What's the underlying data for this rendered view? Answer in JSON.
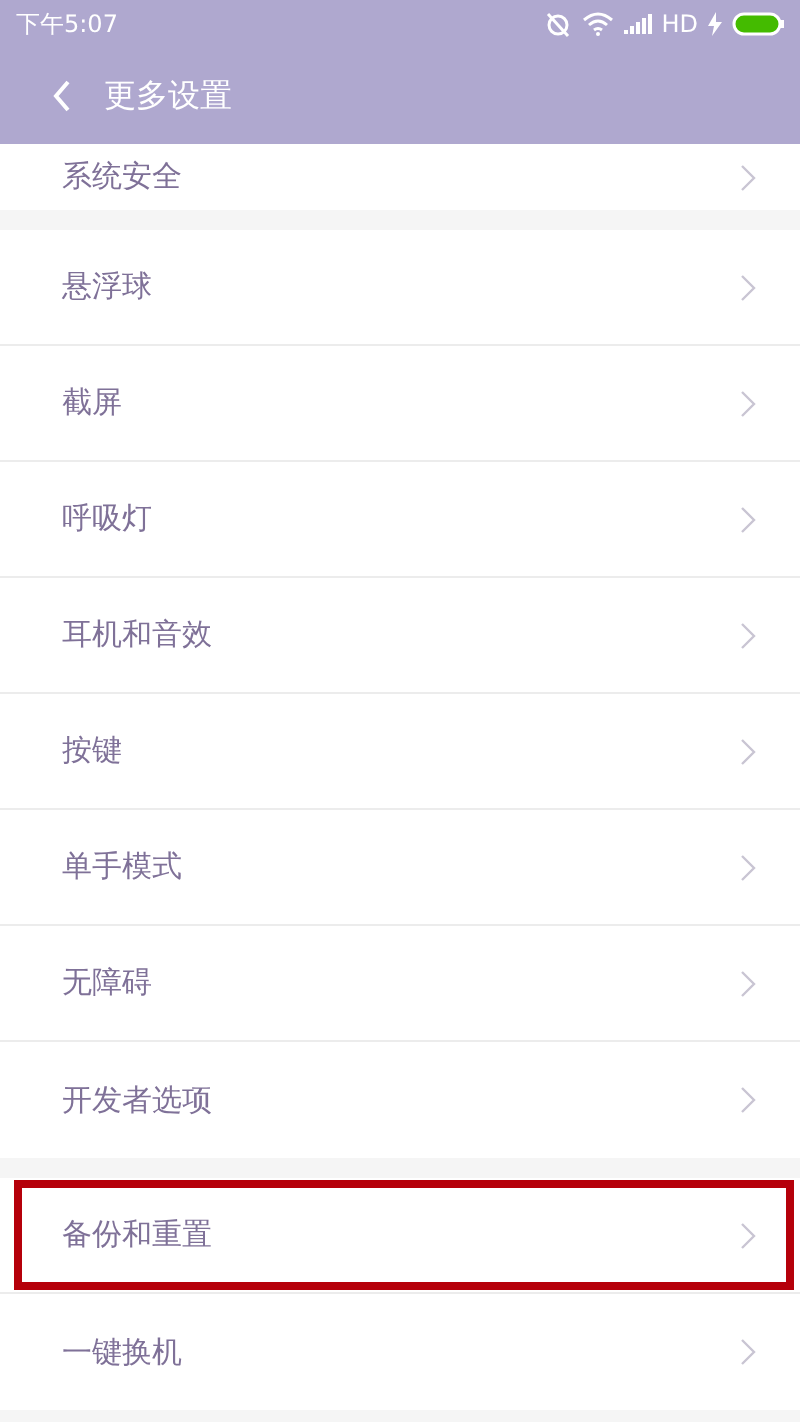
{
  "status_bar": {
    "time": "下午5:07",
    "network": "HD"
  },
  "header": {
    "title": "更多设置"
  },
  "groups": [
    {
      "items": [
        {
          "label": "系统安全",
          "highlighted": false
        }
      ]
    },
    {
      "items": [
        {
          "label": "悬浮球",
          "highlighted": false
        },
        {
          "label": "截屏",
          "highlighted": false
        },
        {
          "label": "呼吸灯",
          "highlighted": false
        },
        {
          "label": "耳机和音效",
          "highlighted": false
        },
        {
          "label": "按键",
          "highlighted": false
        },
        {
          "label": "单手模式",
          "highlighted": false
        },
        {
          "label": "无障碍",
          "highlighted": false
        },
        {
          "label": "开发者选项",
          "highlighted": false
        }
      ]
    },
    {
      "items": [
        {
          "label": "备份和重置",
          "highlighted": true
        },
        {
          "label": "一键换机",
          "highlighted": false
        }
      ]
    }
  ]
}
